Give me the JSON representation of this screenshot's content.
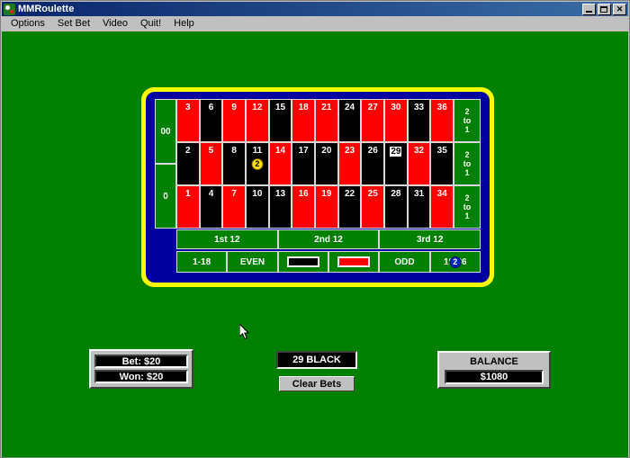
{
  "window": {
    "title": "MMRoulette",
    "icon": "roulette-icon",
    "buttons": {
      "minimize": "_",
      "maximize": "□",
      "close": "✕"
    }
  },
  "menu": {
    "items": [
      {
        "label": "Options"
      },
      {
        "label": "Set Bet"
      },
      {
        "label": "Video"
      },
      {
        "label": "Quit!"
      },
      {
        "label": "Help"
      }
    ]
  },
  "table": {
    "zeros": [
      {
        "label": "00"
      },
      {
        "label": "0"
      }
    ],
    "rows": [
      [
        {
          "n": "3",
          "color": "red"
        },
        {
          "n": "6",
          "color": "black"
        },
        {
          "n": "9",
          "color": "red"
        },
        {
          "n": "12",
          "color": "red"
        },
        {
          "n": "15",
          "color": "black"
        },
        {
          "n": "18",
          "color": "red"
        },
        {
          "n": "21",
          "color": "red"
        },
        {
          "n": "24",
          "color": "black"
        },
        {
          "n": "27",
          "color": "red"
        },
        {
          "n": "30",
          "color": "red"
        },
        {
          "n": "33",
          "color": "black"
        },
        {
          "n": "36",
          "color": "red"
        }
      ],
      [
        {
          "n": "2",
          "color": "black"
        },
        {
          "n": "5",
          "color": "red"
        },
        {
          "n": "8",
          "color": "black"
        },
        {
          "n": "11",
          "color": "black",
          "chip": {
            "value": "2",
            "color": "yellow"
          }
        },
        {
          "n": "14",
          "color": "red"
        },
        {
          "n": "17",
          "color": "black"
        },
        {
          "n": "20",
          "color": "black"
        },
        {
          "n": "23",
          "color": "red"
        },
        {
          "n": "26",
          "color": "black"
        },
        {
          "n": "29",
          "color": "black",
          "highlight": true
        },
        {
          "n": "32",
          "color": "red"
        },
        {
          "n": "35",
          "color": "black"
        }
      ],
      [
        {
          "n": "1",
          "color": "red"
        },
        {
          "n": "4",
          "color": "black"
        },
        {
          "n": "7",
          "color": "red"
        },
        {
          "n": "10",
          "color": "black"
        },
        {
          "n": "13",
          "color": "black"
        },
        {
          "n": "16",
          "color": "red"
        },
        {
          "n": "19",
          "color": "red"
        },
        {
          "n": "22",
          "color": "black"
        },
        {
          "n": "25",
          "color": "red"
        },
        {
          "n": "28",
          "color": "black"
        },
        {
          "n": "31",
          "color": "black"
        },
        {
          "n": "34",
          "color": "red"
        }
      ]
    ],
    "column_bets": [
      {
        "line1": "2",
        "line2": "to",
        "line3": "1"
      },
      {
        "line1": "2",
        "line2": "to",
        "line3": "1"
      },
      {
        "line1": "2",
        "line2": "to",
        "line3": "1"
      }
    ],
    "dozens": [
      {
        "label": "1st 12"
      },
      {
        "label": "2nd 12"
      },
      {
        "label": "3rd 12"
      }
    ],
    "outside": [
      {
        "label": "1-18",
        "kind": "text"
      },
      {
        "label": "EVEN",
        "kind": "text"
      },
      {
        "label": "",
        "kind": "swatch-black"
      },
      {
        "label": "",
        "kind": "swatch-red"
      },
      {
        "label": "ODD",
        "kind": "text"
      },
      {
        "label": "19-36",
        "kind": "text",
        "chip": {
          "value": "2",
          "color": "blue"
        }
      }
    ]
  },
  "status": {
    "bet_label": "Bet: $20",
    "won_label": "Won: $20",
    "result": "29 BLACK",
    "clear_bets_label": "Clear Bets",
    "balance_title": "BALANCE",
    "balance_value": "$1080"
  },
  "colors": {
    "felt": "#008000",
    "table_border": "#ffff00",
    "table_inner": "#0000a0",
    "red": "#ff0000",
    "black": "#000000",
    "green": "#008000",
    "chip_yellow": "#ffe000",
    "chip_blue": "#0020c0"
  }
}
